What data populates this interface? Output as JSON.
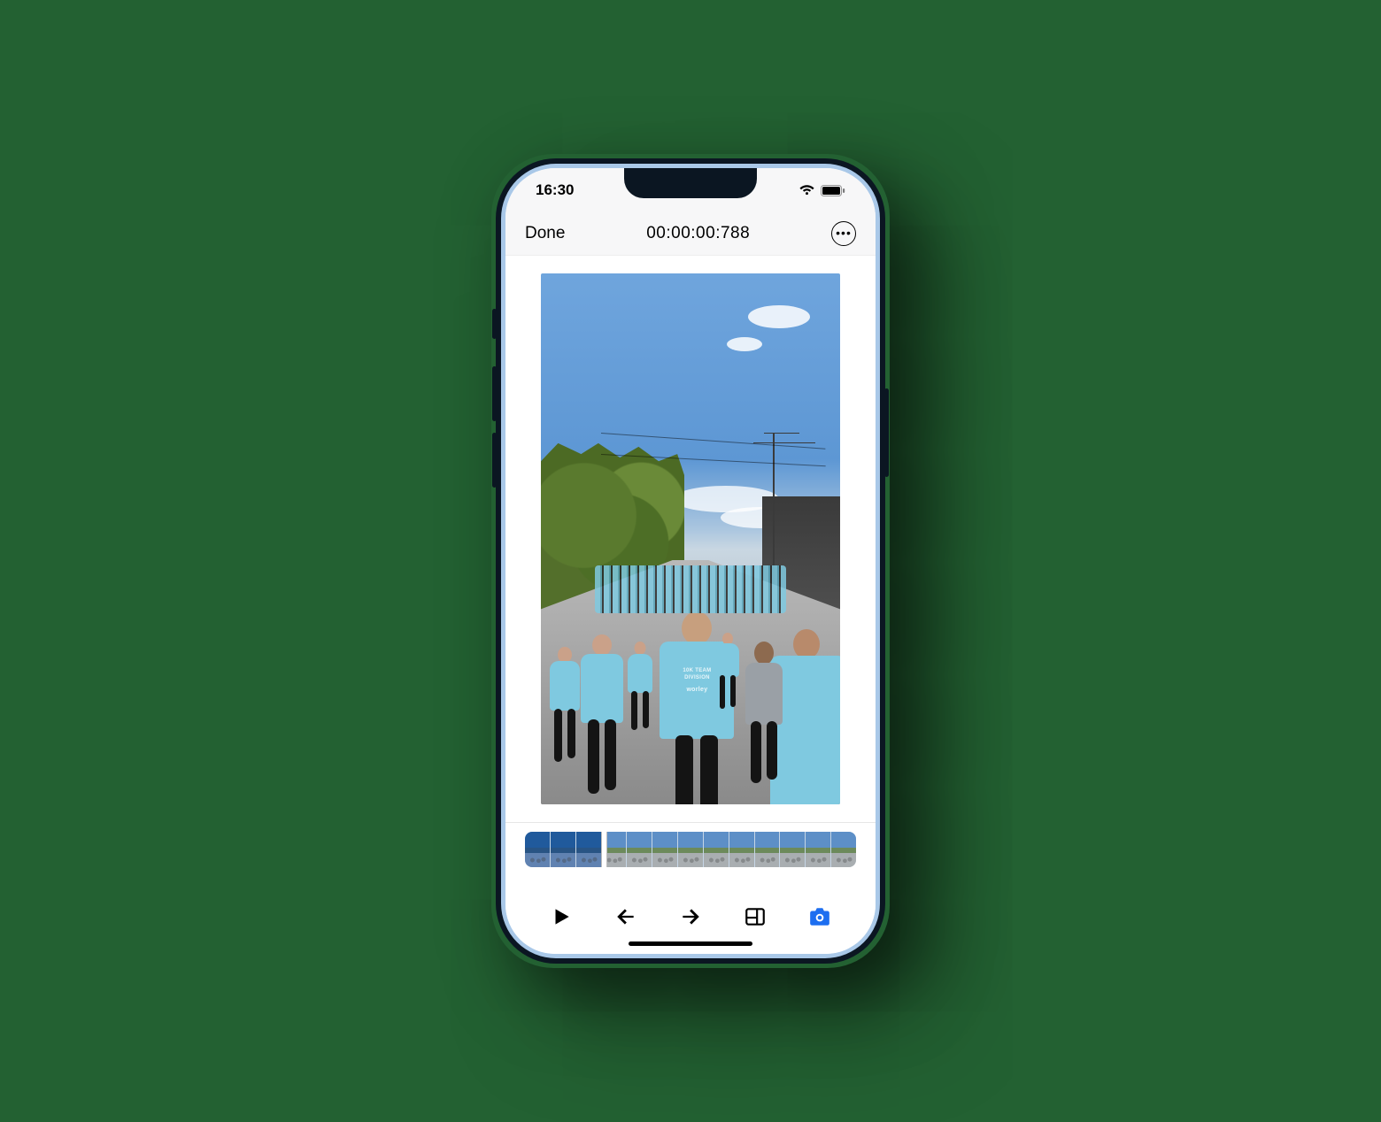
{
  "statusbar": {
    "time": "16:30"
  },
  "nav": {
    "done_label": "Done",
    "timecode": "00:00:00:788"
  },
  "preview": {
    "shirt_line1": "10K TEAM",
    "shirt_line2": "DIVISION",
    "shirt_brand": "worley"
  },
  "timeline": {
    "thumbnail_count": 13,
    "playhead_index": 3
  },
  "toolbar": {
    "buttons": [
      {
        "name": "play",
        "active": false
      },
      {
        "name": "step-back",
        "active": false
      },
      {
        "name": "step-forward",
        "active": false
      },
      {
        "name": "compare",
        "active": false
      },
      {
        "name": "capture-frame",
        "active": true
      }
    ]
  }
}
